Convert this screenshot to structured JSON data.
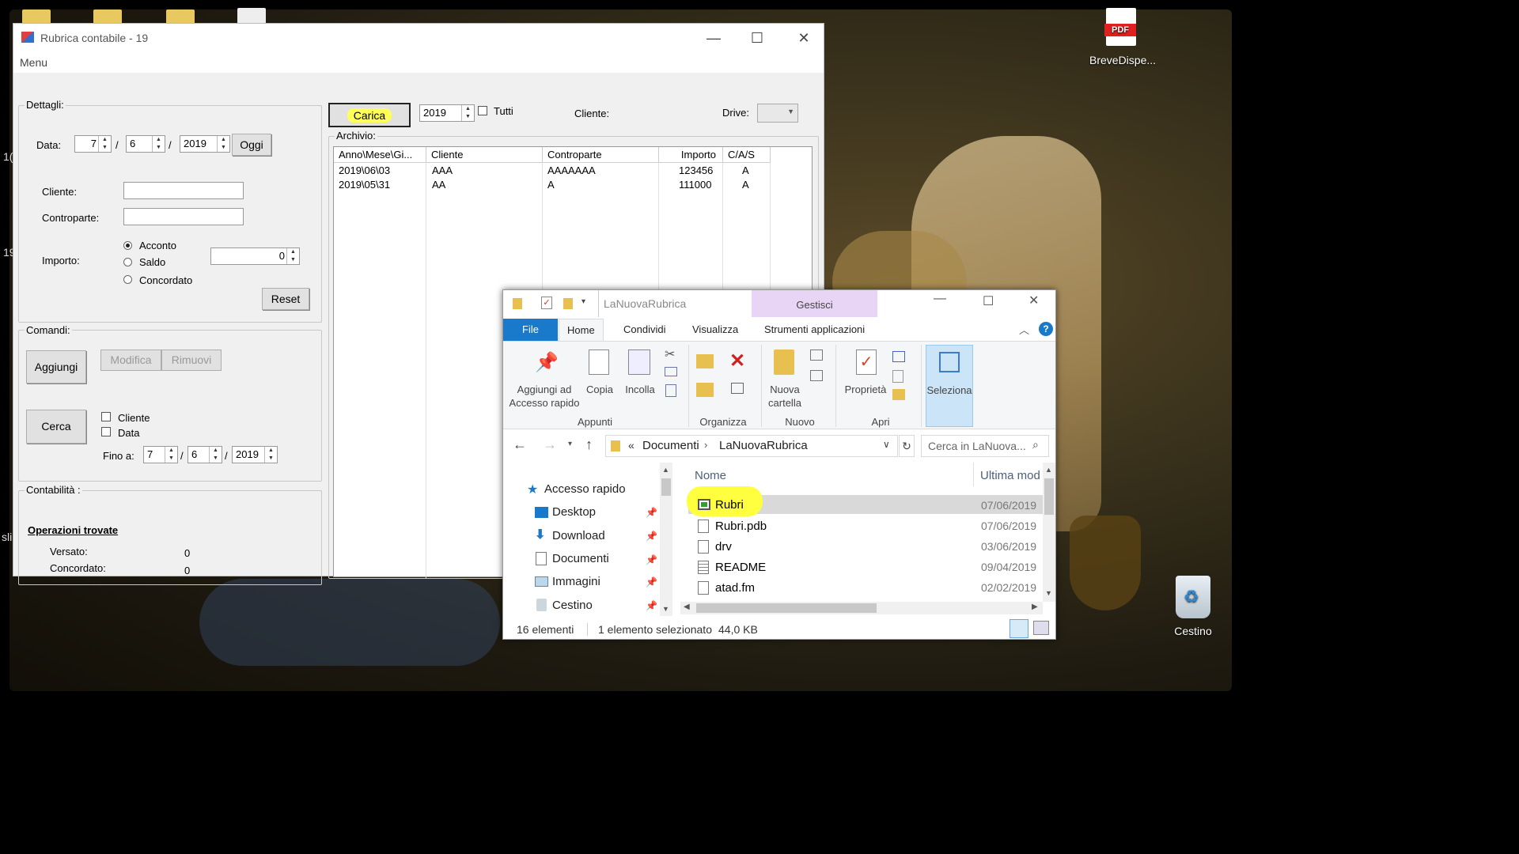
{
  "desktop": {
    "icons": [
      {
        "name": "pdf-file-icon",
        "badge": "PDF",
        "label": "BreveDispe..."
      },
      {
        "name": "recycle-bin-icon",
        "label": "Cestino"
      }
    ],
    "edge_texts": [
      "1(",
      "19",
      "sli"
    ]
  },
  "rubrica": {
    "title": "Rubrica contabile - 19",
    "menu": "Menu",
    "dettagli": {
      "label": "Dettagli:",
      "data_label": "Data:",
      "day": "7",
      "month": "6",
      "year": "2019",
      "oggi": "Oggi",
      "cliente_label": "Cliente:",
      "controparte_label": "Controparte:",
      "importo_label": "Importo:",
      "radio": [
        "Acconto",
        "Saldo",
        "Concordato"
      ],
      "importo_value": "0",
      "reset": "Reset",
      "sep": "/"
    },
    "comandi": {
      "label": "Comandi:",
      "aggiungi": "Aggiungi",
      "modifica": "Modifica",
      "rimuovi": "Rimuovi",
      "cerca": "Cerca",
      "cb_cliente": "Cliente",
      "cb_data": "Data",
      "fino_label": "Fino a:",
      "day": "7",
      "month": "6",
      "year": "2019"
    },
    "contabilita": {
      "label": "Contabilità :",
      "operazioni": "Operazioni trovate",
      "versato_label": "Versato:",
      "versato": "0",
      "concordato_label": "Concordato:",
      "concordato": "0"
    },
    "toolbar": {
      "carica": "Carica",
      "year": "2019",
      "tutti": "Tutti",
      "cliente": "Cliente:",
      "drive": "Drive:"
    },
    "archivio": {
      "label": "Archivio:",
      "columns": [
        "Anno\\Mese\\Gi...",
        "Cliente",
        "Controparte",
        "Importo",
        "C/A/S"
      ],
      "rows": [
        [
          "2019\\06\\03",
          "AAA",
          "AAAAAAA",
          "123456",
          "A"
        ],
        [
          "2019\\05\\31",
          "AA",
          "A",
          "111000",
          "A"
        ]
      ]
    }
  },
  "explorer": {
    "title": "LaNuovaRubrica",
    "context_tab": "Gestisci",
    "tabs": [
      "File",
      "Home",
      "Condividi",
      "Visualizza",
      "Strumenti applicazioni"
    ],
    "ribbon": {
      "pin": "Aggiungi ad Accesso rapido",
      "copia": "Copia",
      "incolla": "Incolla",
      "nuova_cartella": "Nuova cartella",
      "proprieta": "Proprietà",
      "seleziona": "Seleziona",
      "groups": [
        "Appunti",
        "Organizza",
        "Nuovo",
        "Apri"
      ]
    },
    "path": [
      "Documenti",
      "LaNuovaRubrica"
    ],
    "path_prefix": "«",
    "search_placeholder": "Cerca in LaNuova...",
    "nav": [
      "Accesso rapido",
      "Desktop",
      "Download",
      "Documenti",
      "Immagini",
      "Cestino"
    ],
    "col_name": "Nome",
    "col_date": "Ultima mod",
    "files": [
      {
        "name": "Rubri",
        "date": "07/06/2019"
      },
      {
        "name": "Rubri.pdb",
        "date": "07/06/2019"
      },
      {
        "name": "drv",
        "date": "03/06/2019"
      },
      {
        "name": "README",
        "date": "09/04/2019"
      },
      {
        "name": "atad.fm",
        "date": "02/02/2019"
      }
    ],
    "status": {
      "count": "16 elementi",
      "selected": "1 elemento selezionato",
      "size": "44,0 KB"
    },
    "colors": {
      "accent": "#1979ca",
      "context": "#e8d4f4",
      "highlight": "#ffff40"
    }
  }
}
